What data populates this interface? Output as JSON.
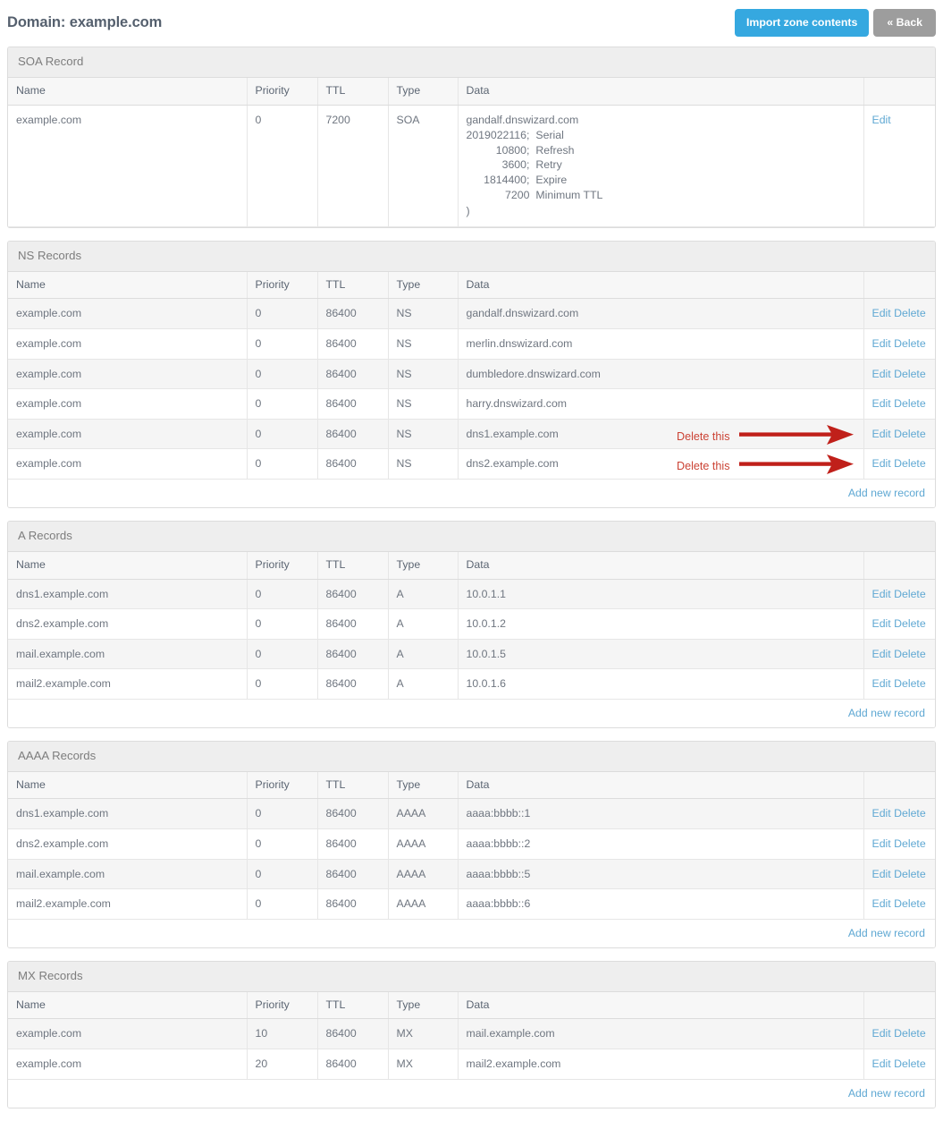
{
  "header": {
    "title": "Domain: example.com",
    "import_label": "Import zone contents",
    "back_label": "« Back"
  },
  "columns": {
    "name": "Name",
    "priority": "Priority",
    "ttl": "TTL",
    "type": "Type",
    "data": "Data",
    "actions": ""
  },
  "links": {
    "edit": "Edit",
    "delete": "Delete",
    "edit_delete": "Edit Delete",
    "add_new": "Add new record"
  },
  "colors": {
    "accent_blue": "#35a8e0",
    "link_blue": "#5fa8d3",
    "back_gray": "#9d9d9d",
    "annotation_red": "#cb4335",
    "arrow_red": "#c0201a",
    "panel_head_bg": "#eeeeee",
    "row_stripe": "#f5f5f5"
  },
  "annotations": [
    {
      "text": "Delete this",
      "target_row": 5,
      "icon": "arrow-right-icon"
    },
    {
      "text": "Delete this",
      "target_row": 6,
      "icon": "arrow-right-icon"
    }
  ],
  "panels": [
    {
      "id": "soa",
      "title": "SOA Record",
      "has_add_new": false,
      "rows": [
        {
          "name": "example.com",
          "priority": "0",
          "ttl": "7200",
          "type": "SOA",
          "data_primary": "gandalf.dnswizard.com",
          "data_lines": [
            {
              "num": "2019022116;",
              "label": "Serial"
            },
            {
              "num": "10800;",
              "label": "Refresh"
            },
            {
              "num": "3600;",
              "label": "Retry"
            },
            {
              "num": "1814400;",
              "label": "Expire"
            },
            {
              "num": "7200",
              "label": "Minimum TTL"
            }
          ],
          "data_close": ")",
          "actions": "edit-only"
        }
      ]
    },
    {
      "id": "ns",
      "title": "NS Records",
      "has_add_new": true,
      "rows": [
        {
          "name": "example.com",
          "priority": "0",
          "ttl": "86400",
          "type": "NS",
          "data": "gandalf.dnswizard.com"
        },
        {
          "name": "example.com",
          "priority": "0",
          "ttl": "86400",
          "type": "NS",
          "data": "merlin.dnswizard.com"
        },
        {
          "name": "example.com",
          "priority": "0",
          "ttl": "86400",
          "type": "NS",
          "data": "dumbledore.dnswizard.com"
        },
        {
          "name": "example.com",
          "priority": "0",
          "ttl": "86400",
          "type": "NS",
          "data": "harry.dnswizard.com"
        },
        {
          "name": "example.com",
          "priority": "0",
          "ttl": "86400",
          "type": "NS",
          "data": "dns1.example.com"
        },
        {
          "name": "example.com",
          "priority": "0",
          "ttl": "86400",
          "type": "NS",
          "data": "dns2.example.com"
        }
      ]
    },
    {
      "id": "a",
      "title": "A Records",
      "has_add_new": true,
      "rows": [
        {
          "name": "dns1.example.com",
          "priority": "0",
          "ttl": "86400",
          "type": "A",
          "data": "10.0.1.1"
        },
        {
          "name": "dns2.example.com",
          "priority": "0",
          "ttl": "86400",
          "type": "A",
          "data": "10.0.1.2"
        },
        {
          "name": "mail.example.com",
          "priority": "0",
          "ttl": "86400",
          "type": "A",
          "data": "10.0.1.5"
        },
        {
          "name": "mail2.example.com",
          "priority": "0",
          "ttl": "86400",
          "type": "A",
          "data": "10.0.1.6"
        }
      ]
    },
    {
      "id": "aaaa",
      "title": "AAAA Records",
      "has_add_new": true,
      "rows": [
        {
          "name": "dns1.example.com",
          "priority": "0",
          "ttl": "86400",
          "type": "AAAA",
          "data": "aaaa:bbbb::1"
        },
        {
          "name": "dns2.example.com",
          "priority": "0",
          "ttl": "86400",
          "type": "AAAA",
          "data": "aaaa:bbbb::2"
        },
        {
          "name": "mail.example.com",
          "priority": "0",
          "ttl": "86400",
          "type": "AAAA",
          "data": "aaaa:bbbb::5"
        },
        {
          "name": "mail2.example.com",
          "priority": "0",
          "ttl": "86400",
          "type": "AAAA",
          "data": "aaaa:bbbb::6"
        }
      ]
    },
    {
      "id": "mx",
      "title": "MX Records",
      "has_add_new": true,
      "rows": [
        {
          "name": "example.com",
          "priority": "10",
          "ttl": "86400",
          "type": "MX",
          "data": "mail.example.com"
        },
        {
          "name": "example.com",
          "priority": "20",
          "ttl": "86400",
          "type": "MX",
          "data": "mail2.example.com"
        }
      ]
    }
  ]
}
